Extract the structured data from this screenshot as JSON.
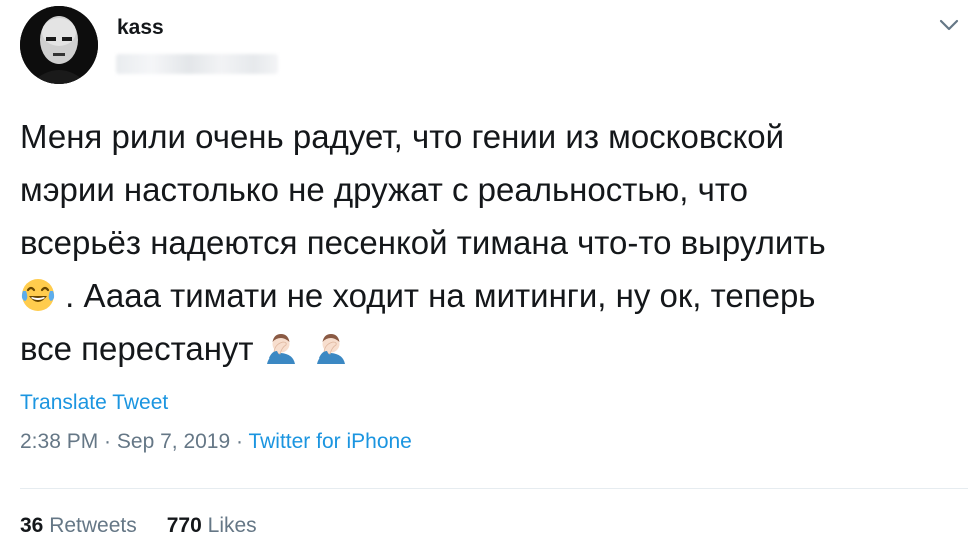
{
  "user": {
    "display_name": "kass"
  },
  "tweet": {
    "lines": [
      "Меня рили очень радует, что гении из московской",
      "мэрии настолько не дружат с реальностью, что",
      "всерьёз надеются песенкой тимана что-то вырулить",
      " . Аааа тимати не ходит на митинги, ну ок, теперь",
      "все перестанут "
    ],
    "emoji": {
      "line4_start": "face-with-tears-of-joy-emoji",
      "line5_end": [
        "person-facepalming-emoji",
        "person-facepalming-emoji"
      ]
    }
  },
  "translate_label": "Translate Tweet",
  "meta": {
    "time": "2:38 PM",
    "separator": " · ",
    "date": "Sep 7, 2019",
    "source": "Twitter for iPhone"
  },
  "stats": {
    "retweets_count": "36",
    "retweets_label": "Retweets",
    "likes_count": "770",
    "likes_label": "Likes"
  },
  "colors": {
    "text": "#14171a",
    "secondary": "#657786",
    "link": "#1b95e0",
    "divider": "#e6ecf0"
  }
}
